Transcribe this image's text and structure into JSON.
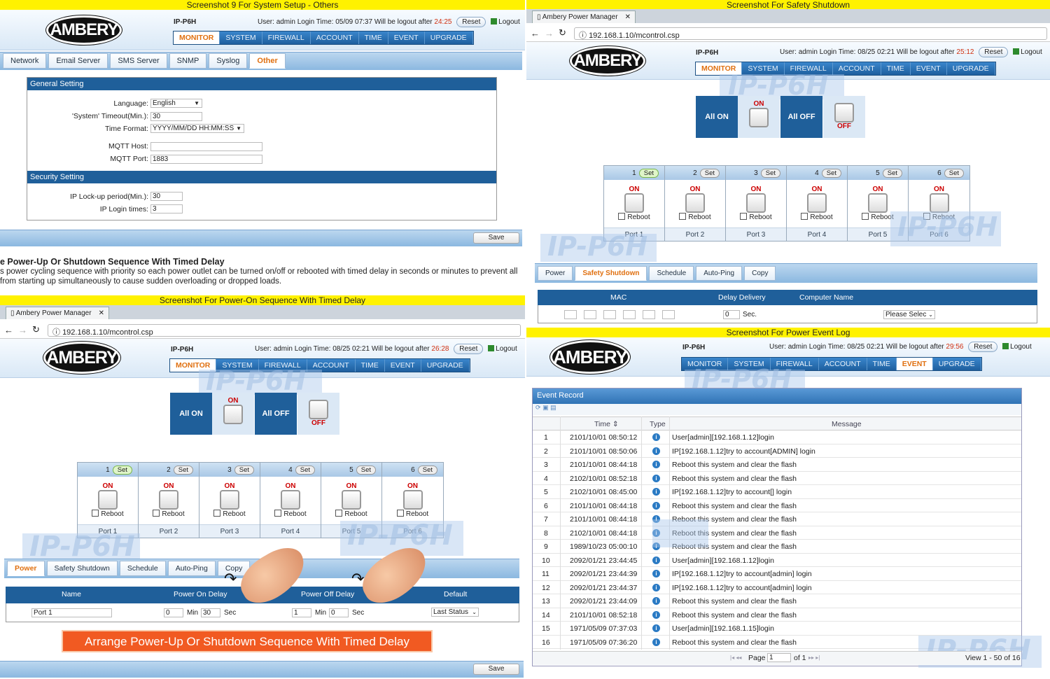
{
  "titles": {
    "q1": "Screenshot 9 For System Setup - Others",
    "q2": "Screenshot For Safety Shutdown",
    "q3": "Screenshot For Power-On Sequence With Timed Delay",
    "q4": "Screenshot For Power Event Log"
  },
  "common": {
    "logo": "AMBERY",
    "model": "IP-P6H",
    "user_label": "User:",
    "user": "admin",
    "login_label": "Login Time:",
    "logout_after_label": "Will be logout after",
    "reset": "Reset",
    "logout": "Logout",
    "browser_tab": "Ambery Power Manager",
    "url": "192.168.1.10/mcontrol.csp",
    "watermark": "IP-P6H",
    "nav": [
      "MONITOR",
      "SYSTEM",
      "FIREWALL",
      "ACCOUNT",
      "TIME",
      "EVENT",
      "UPGRADE"
    ],
    "save": "Save"
  },
  "q1": {
    "login_time": "05/09 07:37",
    "countdown": "24:25",
    "subtabs": [
      "Network",
      "Email Server",
      "SMS Server",
      "SNMP",
      "Syslog",
      "Other"
    ],
    "general_title": "General Setting",
    "language_label": "Language:",
    "language_value": "English",
    "timeout_label": "'System' Timeout(Min.):",
    "timeout_value": "30",
    "timeformat_label": "Time Format:",
    "timeformat_value": "YYYY/MM/DD HH:MM:SS",
    "mqtt_host_label": "MQTT Host:",
    "mqtt_host_value": "",
    "mqtt_port_label": "MQTT Port:",
    "mqtt_port_value": "1883",
    "security_title": "Security Setting",
    "lockup_label": "IP Lock-up period(Min.):",
    "lockup_value": "30",
    "login_times_label": "IP Login times:",
    "login_times_value": "3"
  },
  "desc": {
    "title": "e Power-Up Or Shutdown Sequence With Timed Delay",
    "line1": "s power cycling sequence with priority so each power outlet can be turned on/off or rebooted with timed delay in seconds or minutes to prevent all",
    "line2": " from starting up simultaneously to cause sudden overloading or dropped loads."
  },
  "control": {
    "all_on": "All ON",
    "all_off": "All OFF",
    "on": "ON",
    "off": "OFF",
    "set": "Set",
    "reboot": "Reboot",
    "ports": [
      "1",
      "2",
      "3",
      "4",
      "5",
      "6"
    ],
    "port_names": [
      "Port 1",
      "Port 2",
      "Port 3",
      "Port 4",
      "Port 5",
      "Port 6"
    ],
    "bottom_tabs": [
      "Power",
      "Safety Shutdown",
      "Schedule",
      "Auto-Ping",
      "Copy"
    ]
  },
  "q2": {
    "login_time": "08/25 02:21",
    "countdown": "25:12",
    "col_mac": "MAC",
    "col_delay": "Delay Delivery",
    "col_computer": "Computer Name",
    "delay_value": "0",
    "sec": "Sec.",
    "select": "Please Selec"
  },
  "q3": {
    "login_time": "08/25 02:21",
    "countdown": "26:28",
    "col_name": "Name",
    "col_on": "Power On Delay",
    "col_off": "Power Off Delay",
    "col_default": "Default",
    "name_value": "Port 1",
    "on_min": "0",
    "on_sec": "30",
    "off_min": "1",
    "off_sec": "0",
    "min": "Min",
    "sec": "Sec",
    "default_value": "Last Status",
    "banner": "Arrange Power-Up Or Shutdown Sequence With Timed Delay"
  },
  "q4": {
    "login_time": "08/25 02:21",
    "countdown": "29:56",
    "panel_title": "Event Record",
    "col_time": "Time",
    "col_type": "Type",
    "col_message": "Message",
    "rows": [
      {
        "n": "1",
        "time": "2101/10/01 08:50:12",
        "msg": "User[admin][192.168.1.12]login"
      },
      {
        "n": "2",
        "time": "2101/10/01 08:50:06",
        "msg": "IP[192.168.1.12]try to account[ADMIN] login"
      },
      {
        "n": "3",
        "time": "2101/10/01 08:44:18",
        "msg": "Reboot this system and clear the flash"
      },
      {
        "n": "4",
        "time": "2102/10/01 08:52:18",
        "msg": "Reboot this system and clear the flash"
      },
      {
        "n": "5",
        "time": "2102/10/01 08:45:00",
        "msg": "IP[192.168.1.12]try to account[] login"
      },
      {
        "n": "6",
        "time": "2101/10/01 08:44:18",
        "msg": "Reboot this system and clear the flash"
      },
      {
        "n": "7",
        "time": "2101/10/01 08:44:18",
        "msg": "Reboot this system and clear the flash"
      },
      {
        "n": "8",
        "time": "2102/10/01 08:44:18",
        "msg": "Reboot this system and clear the flash"
      },
      {
        "n": "9",
        "time": "1989/10/23 05:00:10",
        "msg": "Reboot this system and clear the flash"
      },
      {
        "n": "10",
        "time": "2092/01/21 23:44:45",
        "msg": "User[admin][192.168.1.12]login"
      },
      {
        "n": "11",
        "time": "2092/01/21 23:44:39",
        "msg": "IP[192.168.1.12]try to account[admin] login"
      },
      {
        "n": "12",
        "time": "2092/01/21 23:44:37",
        "msg": "IP[192.168.1.12]try to account[admin] login"
      },
      {
        "n": "13",
        "time": "2092/01/21 23:44:09",
        "msg": "Reboot this system and clear the flash"
      },
      {
        "n": "14",
        "time": "2101/10/01 08:52:18",
        "msg": "Reboot this system and clear the flash"
      },
      {
        "n": "15",
        "time": "1971/05/09 07:37:03",
        "msg": "User[admin][192.168.1.15]login"
      },
      {
        "n": "16",
        "time": "1971/05/09 07:36:20",
        "msg": "Reboot this system and clear the flash"
      }
    ],
    "page_label": "Page",
    "page_value": "1",
    "of_label": "of 1",
    "view_info": "View 1 - 50 of 16"
  }
}
